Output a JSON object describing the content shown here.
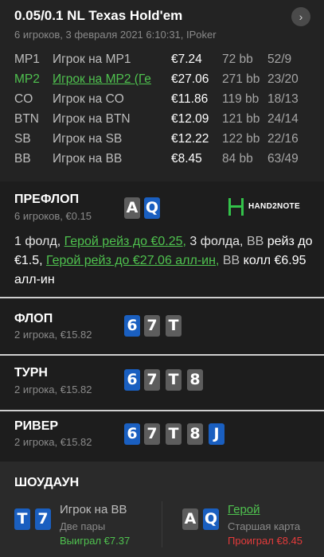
{
  "header": {
    "title": "0.05/0.1 NL Texas Hold'em",
    "subtitle": "6 игроков, 3 февраля 2021 6:10:31, IPoker",
    "next_icon": "›"
  },
  "players": [
    {
      "pos": "MP1",
      "name": "Игрок на MP1",
      "stack": "€7.24",
      "bb": "72 bb",
      "stat": "52/9",
      "hero": false
    },
    {
      "pos": "MP2",
      "name": "Игрок на MP2 (Ге",
      "stack": "€27.06",
      "bb": "271 bb",
      "stat": "23/20",
      "hero": true
    },
    {
      "pos": "CO",
      "name": "Игрок на CO",
      "stack": "€11.86",
      "bb": "119 bb",
      "stat": "18/13",
      "hero": false
    },
    {
      "pos": "BTN",
      "name": "Игрок на BTN",
      "stack": "€12.09",
      "bb": "121 bb",
      "stat": "24/14",
      "hero": false
    },
    {
      "pos": "SB",
      "name": "Игрок на SB",
      "stack": "€12.22",
      "bb": "122 bb",
      "stat": "22/16",
      "hero": false
    },
    {
      "pos": "BB",
      "name": "Игрок на BB",
      "stack": "€8.45",
      "bb": "84 bb",
      "stat": "63/49",
      "hero": false
    }
  ],
  "preflop": {
    "title": "ПРЕФЛОП",
    "sub": "6 игроков, €0.15",
    "cards": [
      "A",
      "Q"
    ],
    "logo": "HAND2NOTE",
    "action": {
      "p1": "1 фолд, ",
      "hero_raise": "Герой рейз до €0.25,",
      "p2": " 3 фолда, ",
      "bb1": "BB",
      "p3": " рейз до €1.5, ",
      "hero_allin": "Герой рейз до €27.06 алл-ин,",
      "p4": " ",
      "bb2": "BB",
      "p5": " колл €6.95 алл-ин"
    }
  },
  "flop": {
    "title": "ФЛОП",
    "sub": "2 игрока, €15.82",
    "cards": [
      "6",
      "7",
      "T"
    ]
  },
  "turn": {
    "title": "ТУРН",
    "sub": "2 игрока, €15.82",
    "cards": [
      "6",
      "7",
      "T",
      "8"
    ]
  },
  "river": {
    "title": "РИВЕР",
    "sub": "2 игрока, €15.82",
    "cards": [
      "6",
      "7",
      "T",
      "8",
      "J"
    ]
  },
  "showdown": {
    "title": "ШОУДАУН",
    "left": {
      "cards": [
        "T",
        "7"
      ],
      "name": "Игрок на BB",
      "hand": "Две пары",
      "result": "Выиграл €7.37"
    },
    "right": {
      "cards": [
        "A",
        "Q"
      ],
      "name": "Герой",
      "hand": "Старшая карта",
      "result": "Проиграл €8.45"
    }
  },
  "colors": {
    "hero": "#4fc24f",
    "win": "#4fc24f",
    "loss": "#e53b3b",
    "card_diamond": "#1a5fc0",
    "card_spade": "#5d5d5d"
  }
}
